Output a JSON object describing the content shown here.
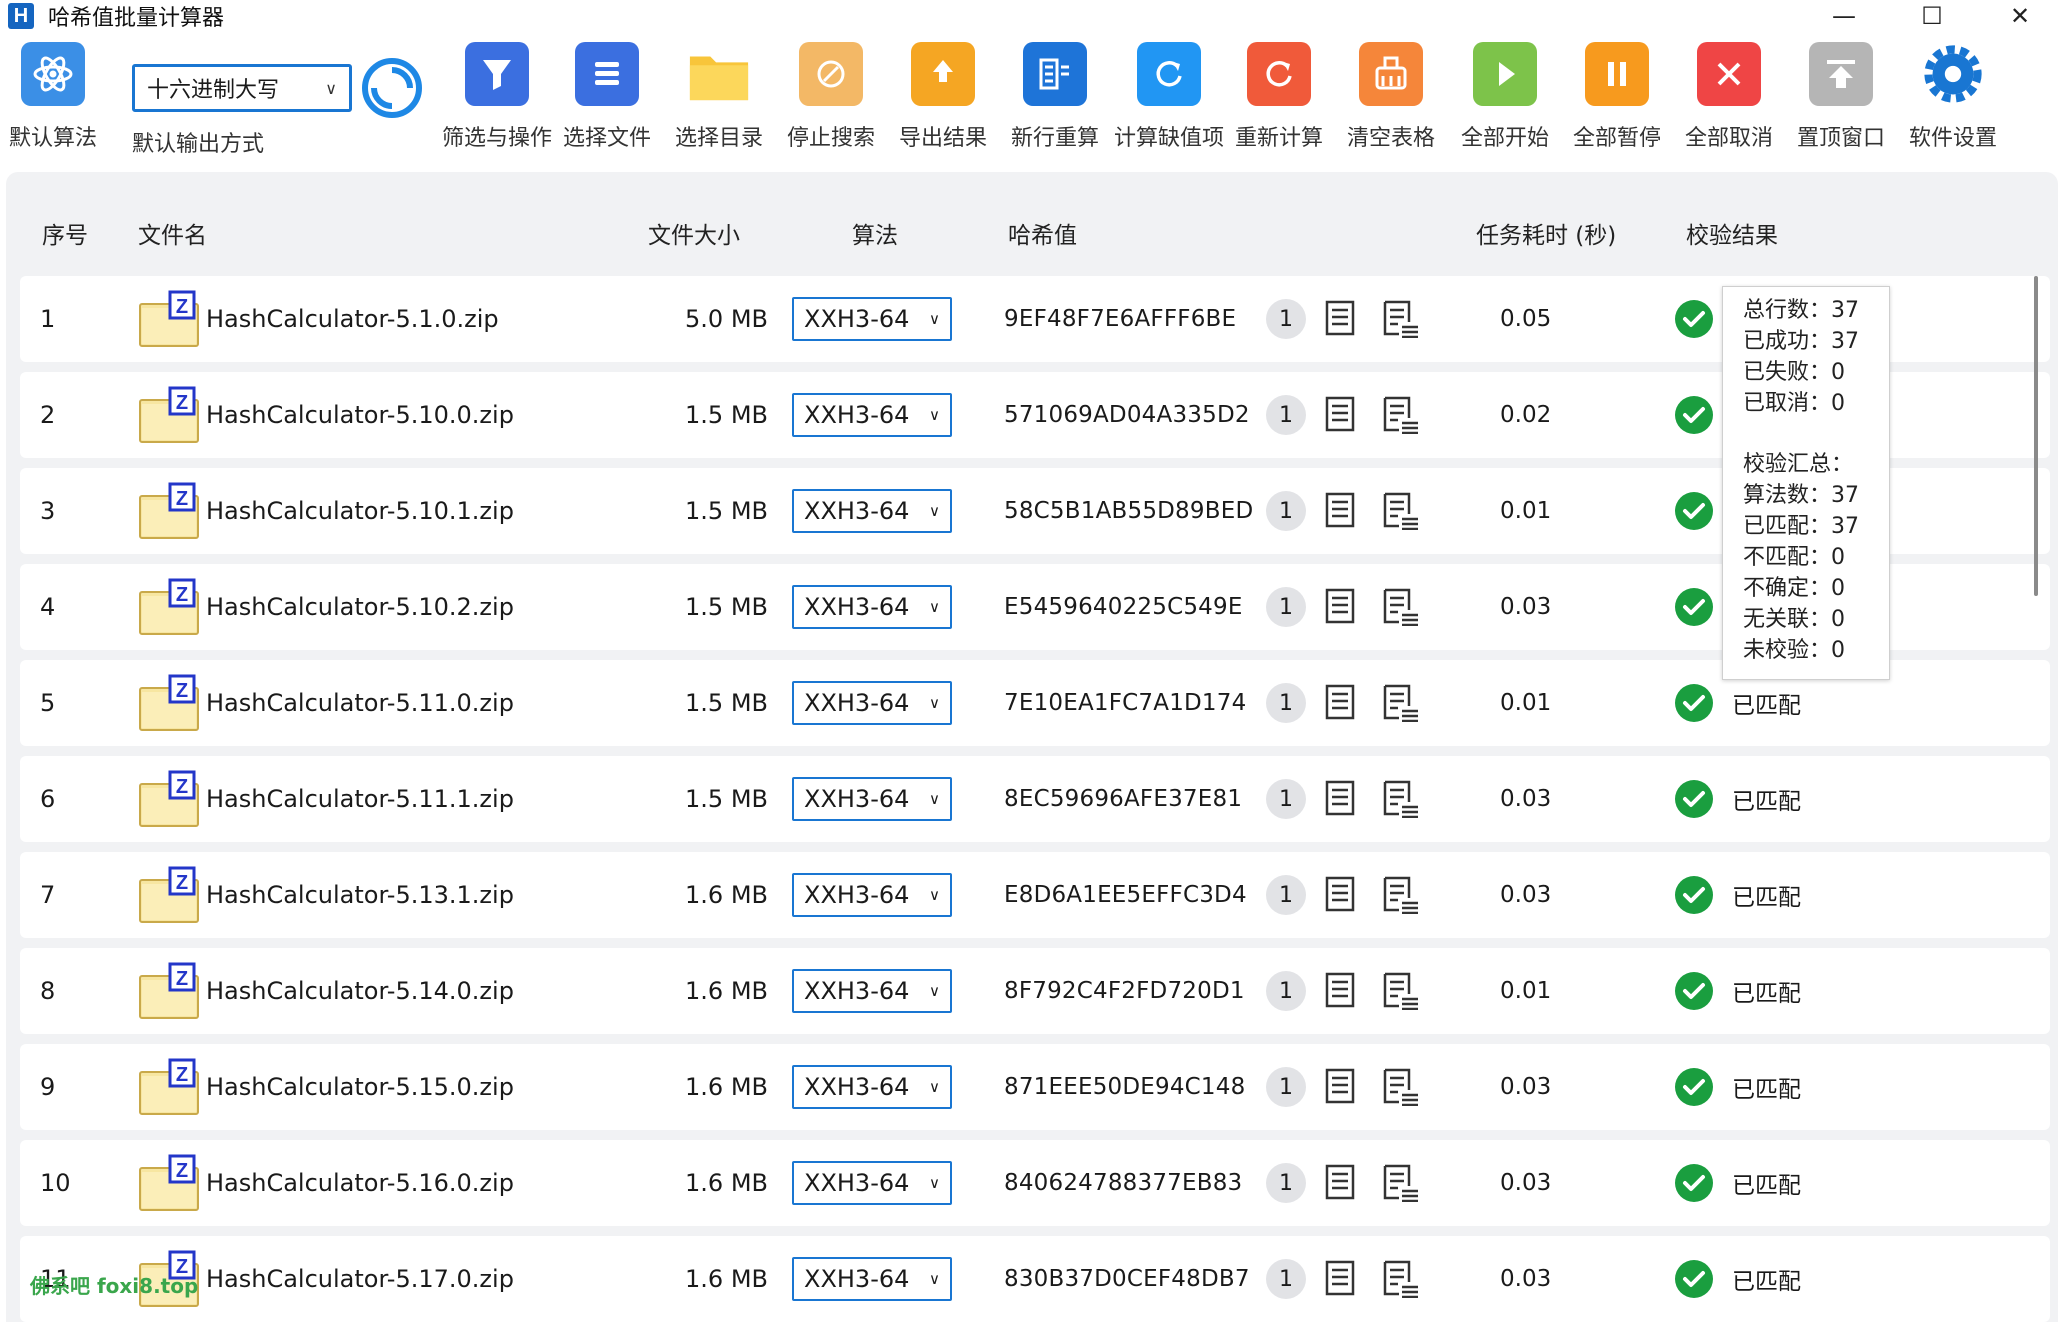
{
  "window": {
    "title": "哈希值批量计算器",
    "icon_letter": "H",
    "minimize": "—",
    "maximize": "☐",
    "close": "✕"
  },
  "toolbar": {
    "default_algo_label": "默认算法",
    "output_select_value": "十六进制大写",
    "output_label": "默认输出方式",
    "buttons": [
      {
        "label": "筛选与操作",
        "color": "#3b6fe0",
        "icon": "filter-icon"
      },
      {
        "label": "选择文件",
        "color": "#3b6fe0",
        "icon": "file-list-icon"
      },
      {
        "label": "选择目录",
        "color": "#f8c53a",
        "icon": "folder-icon"
      },
      {
        "label": "停止搜索",
        "color": "#f3b866",
        "icon": "stop-search-icon"
      },
      {
        "label": "导出结果",
        "color": "#f5a623",
        "icon": "export-icon"
      },
      {
        "label": "新行重算",
        "color": "#1e74d8",
        "icon": "new-row-recalc-icon"
      },
      {
        "label": "计算缺值项",
        "color": "#2196f3",
        "icon": "calc-missing-icon"
      },
      {
        "label": "重新计算",
        "color": "#f05a3a",
        "icon": "recalc-icon"
      },
      {
        "label": "清空表格",
        "color": "#f5863a",
        "icon": "clear-table-icon"
      },
      {
        "label": "全部开始",
        "color": "#7dc34a",
        "icon": "play-icon"
      },
      {
        "label": "全部暂停",
        "color": "#f79a1e",
        "icon": "pause-icon"
      },
      {
        "label": "全部取消",
        "color": "#ef4545",
        "icon": "cancel-icon"
      },
      {
        "label": "置顶窗口",
        "color": "#b5b5b5",
        "icon": "pin-top-icon"
      },
      {
        "label": "软件设置",
        "color": "#1976d2",
        "icon": "gear-icon"
      }
    ]
  },
  "table": {
    "headers": {
      "idx": "序号",
      "name": "文件名",
      "size": "文件大小",
      "algo": "算法",
      "hash": "哈希值",
      "time": "任务耗时 (秒)",
      "result": "校验结果"
    },
    "rows": [
      {
        "idx": "1",
        "name": "HashCalculator-5.1.0.zip",
        "size": "5.0 MB",
        "algo": "XXH3-64",
        "hash": "9EF48F7E6AFFF6BE",
        "count": "1",
        "time": "0.05",
        "result": ""
      },
      {
        "idx": "2",
        "name": "HashCalculator-5.10.0.zip",
        "size": "1.5 MB",
        "algo": "XXH3-64",
        "hash": "571069AD04A335D2",
        "count": "1",
        "time": "0.02",
        "result": ""
      },
      {
        "idx": "3",
        "name": "HashCalculator-5.10.1.zip",
        "size": "1.5 MB",
        "algo": "XXH3-64",
        "hash": "58C5B1AB55D89BED",
        "count": "1",
        "time": "0.01",
        "result": ""
      },
      {
        "idx": "4",
        "name": "HashCalculator-5.10.2.zip",
        "size": "1.5 MB",
        "algo": "XXH3-64",
        "hash": "E5459640225C549E",
        "count": "1",
        "time": "0.03",
        "result": ""
      },
      {
        "idx": "5",
        "name": "HashCalculator-5.11.0.zip",
        "size": "1.5 MB",
        "algo": "XXH3-64",
        "hash": "7E10EA1FC7A1D174",
        "count": "1",
        "time": "0.01",
        "result": "已匹配"
      },
      {
        "idx": "6",
        "name": "HashCalculator-5.11.1.zip",
        "size": "1.5 MB",
        "algo": "XXH3-64",
        "hash": "8EC59696AFE37E81",
        "count": "1",
        "time": "0.03",
        "result": "已匹配"
      },
      {
        "idx": "7",
        "name": "HashCalculator-5.13.1.zip",
        "size": "1.6 MB",
        "algo": "XXH3-64",
        "hash": "E8D6A1EE5EFFC3D4",
        "count": "1",
        "time": "0.03",
        "result": "已匹配"
      },
      {
        "idx": "8",
        "name": "HashCalculator-5.14.0.zip",
        "size": "1.6 MB",
        "algo": "XXH3-64",
        "hash": "8F792C4F2FD720D1",
        "count": "1",
        "time": "0.01",
        "result": "已匹配"
      },
      {
        "idx": "9",
        "name": "HashCalculator-5.15.0.zip",
        "size": "1.6 MB",
        "algo": "XXH3-64",
        "hash": "871EEE50DE94C148",
        "count": "1",
        "time": "0.03",
        "result": "已匹配"
      },
      {
        "idx": "10",
        "name": "HashCalculator-5.16.0.zip",
        "size": "1.6 MB",
        "algo": "XXH3-64",
        "hash": "840624788377EB83",
        "count": "1",
        "time": "0.03",
        "result": "已匹配"
      },
      {
        "idx": "11",
        "name": "HashCalculator-5.17.0.zip",
        "size": "1.6 MB",
        "algo": "XXH3-64",
        "hash": "830B37D0CEF48DB7",
        "count": "1",
        "time": "0.03",
        "result": "已匹配"
      }
    ]
  },
  "tooltip": {
    "lines_top": [
      "总行数：37",
      "已成功：37",
      "已失败：0",
      "已取消：0"
    ],
    "lines_bottom": [
      "校验汇总：",
      "算法数：37",
      "已匹配：37",
      "不匹配：0",
      "不确定：0",
      "无关联：0",
      "未校验：0"
    ]
  },
  "watermark": "佛系吧  foxi8.top"
}
